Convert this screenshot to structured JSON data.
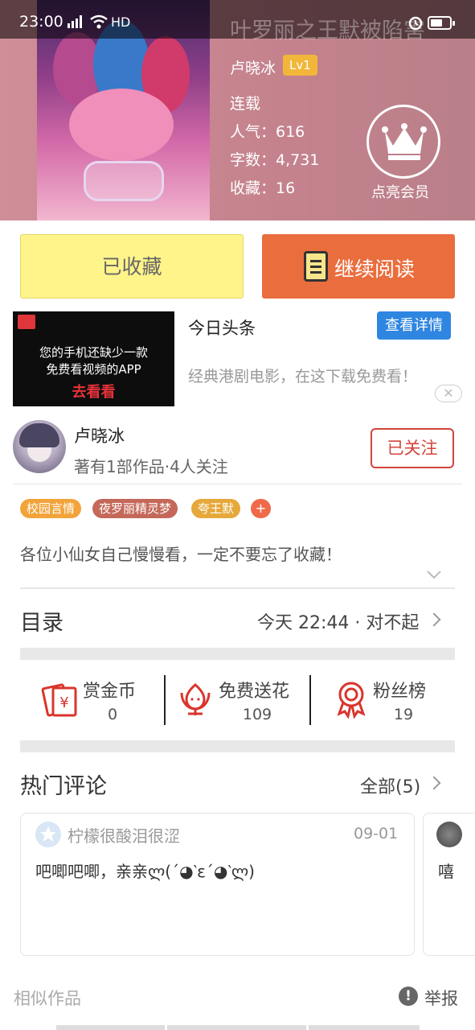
{
  "status_bar": {
    "time": "23:00",
    "network": "4G",
    "quality": "HD"
  },
  "book": {
    "title": "叶罗丽之王默被陷害",
    "author": "卢晓冰",
    "level": "Lv1",
    "status": "连载",
    "popularity": "人气：616",
    "words": "字数：4,731",
    "favorites": "收藏：16",
    "vip_label": "点亮会员",
    "cover_icon": "book-cover-image"
  },
  "actions": {
    "collected_label": "已收藏",
    "read_label": "继续阅读",
    "read_icon": "book-icon"
  },
  "ad": {
    "title": "今日头条",
    "detail_label": "查看详情",
    "desc": "经典港剧电影，在这下载免费看！",
    "img_line1": "您的手机还缺少一款",
    "img_line2": "免费看视频的APP",
    "img_cta": "去看看",
    "close_symbol": "✕"
  },
  "author_card": {
    "name": "卢晓冰",
    "meta": "著有1部作品·4人关注",
    "follow_label": "已关注"
  },
  "tags": [
    {
      "label": "校园言情",
      "color": "#f2a43a"
    },
    {
      "label": "夜罗丽精灵梦",
      "color": "#c4685a"
    },
    {
      "label": "夸王默",
      "color": "#e6a83a"
    }
  ],
  "tag_plus": "+",
  "description": "各位小仙女自己慢慢看，一定不要忘了收藏！",
  "catalog": {
    "title": "目录",
    "latest": "今天 22:44 · 对不起"
  },
  "stats": [
    {
      "label": "赏金币",
      "value": "0",
      "icon": "red-envelope-icon"
    },
    {
      "label": "免费送花",
      "value": "109",
      "icon": "flower-icon"
    },
    {
      "label": "粉丝榜",
      "value": "19",
      "icon": "medal-icon"
    }
  ],
  "comments": {
    "title": "热门评论",
    "all_label": "全部(5)",
    "items": [
      {
        "user": "柠檬很酸泪很涩",
        "date": "09-01",
        "text": "吧唧吧唧，亲亲ლ(´◕‵ε´◕‵ლ)"
      },
      {
        "user": "",
        "date": "",
        "text": "嘻"
      }
    ]
  },
  "footer": {
    "similar_label": "相似作品",
    "report_label": "举报",
    "report_icon": "!"
  },
  "colors": {
    "accent_orange": "#ea6d3e",
    "collected_yellow": "#fff48a",
    "follow_red": "#d3443a",
    "ad_blue": "#2f86e0"
  }
}
